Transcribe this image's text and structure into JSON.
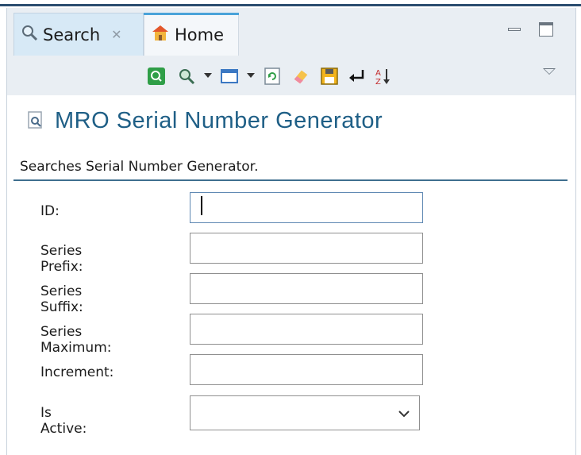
{
  "tabs": [
    {
      "label": "Search",
      "icon": "search-icon"
    },
    {
      "label": "Home",
      "icon": "home-icon"
    }
  ],
  "toolbar": {
    "icons": [
      "search-run-icon",
      "zoom-search-icon",
      "dropdown-arrow",
      "window-icon",
      "dropdown-arrow",
      "refresh-icon",
      "eraser-icon",
      "save-icon",
      "enter-icon",
      "sort-icon"
    ],
    "view_menu": "chevron-down-icon"
  },
  "page": {
    "title": "MRO Serial Number Generator",
    "description": "Searches Serial Number Generator."
  },
  "form": {
    "fields": [
      {
        "label": "ID:",
        "value": ""
      },
      {
        "label": "Series Prefix:",
        "value": ""
      },
      {
        "label": "Series Suffix:",
        "value": ""
      },
      {
        "label": "Series Maximum:",
        "value": ""
      },
      {
        "label": "Increment:",
        "value": ""
      }
    ],
    "is_active": {
      "label": "Is Active:",
      "value": ""
    }
  },
  "colors": {
    "title": "#1f5f86",
    "tab_active_bg": "#d7e9f6",
    "toolbar_bg": "#e9eef3",
    "accent": "#4aa3d9"
  }
}
